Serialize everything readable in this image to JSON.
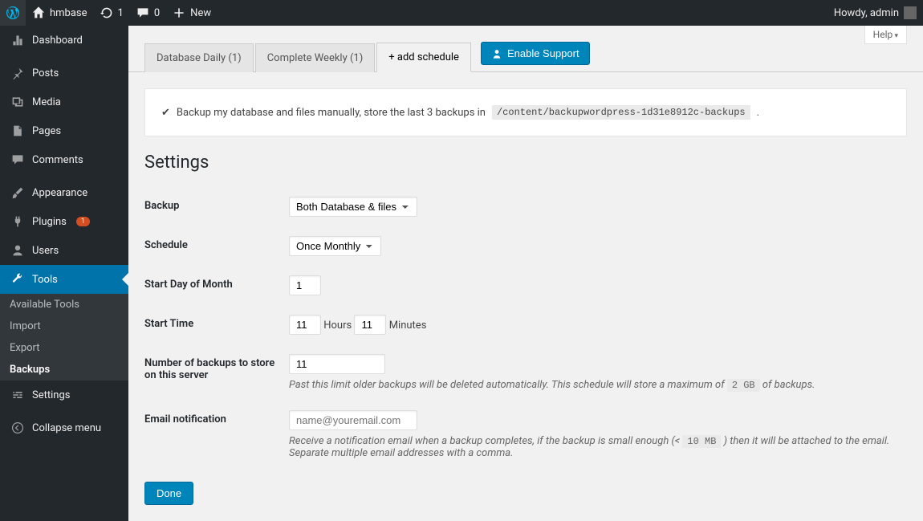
{
  "adminbar": {
    "site_name": "hmbase",
    "updates_count": "1",
    "comments_count": "0",
    "new_label": "New",
    "howdy": "Howdy, admin"
  },
  "sidebar": {
    "dashboard": "Dashboard",
    "posts": "Posts",
    "media": "Media",
    "pages": "Pages",
    "comments": "Comments",
    "appearance": "Appearance",
    "plugins": "Plugins",
    "plugins_count": "1",
    "users": "Users",
    "tools": "Tools",
    "settings": "Settings",
    "collapse": "Collapse menu",
    "submenu": {
      "available_tools": "Available Tools",
      "import": "Import",
      "export": "Export",
      "backups": "Backups"
    }
  },
  "help_label": "Help",
  "tabs": {
    "db_daily": "Database Daily (1)",
    "complete_weekly": "Complete Weekly (1)",
    "add_schedule": "+ add schedule",
    "enable_support": "Enable Support"
  },
  "summary": {
    "text": "Backup my database and files manually, store the last 3 backups in",
    "path": "/content/backupwordpress-1d31e8912c-backups",
    "tail": "."
  },
  "settings": {
    "heading": "Settings",
    "rows": {
      "backup": {
        "label": "Backup",
        "value": "Both Database & files"
      },
      "schedule": {
        "label": "Schedule",
        "value": "Once Monthly"
      },
      "start_day": {
        "label": "Start Day of Month",
        "value": "1"
      },
      "start_time": {
        "label": "Start Time",
        "hours": "11",
        "hours_label": "Hours",
        "minutes": "11",
        "minutes_label": "Minutes"
      },
      "num_backups": {
        "label": "Number of backups to store on this server",
        "value": "11",
        "desc_a": "Past this limit older backups will be deleted automatically. This schedule will store a maximum of",
        "size": "2 GB",
        "desc_b": "of backups."
      },
      "email": {
        "label": "Email notification",
        "placeholder": "name@youremail.com",
        "desc_a": "Receive a notification email when a backup completes, if the backup is small enough (<",
        "size": "10 MB",
        "desc_b": ") then it will be attached to the email. Separate multiple email addresses with a comma."
      }
    },
    "done": "Done"
  }
}
